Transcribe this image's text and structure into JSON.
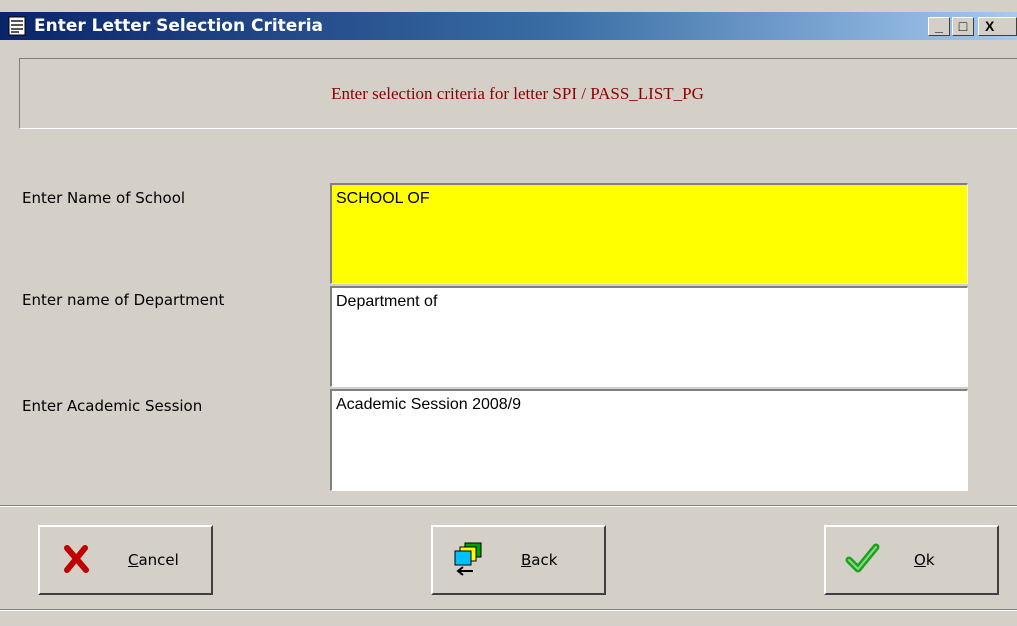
{
  "window": {
    "title": "Enter Letter Selection Criteria",
    "controls": {
      "minimize": "_",
      "maximize": "□",
      "close": "X"
    }
  },
  "header": {
    "text": "Enter selection criteria for letter SPI / PASS_LIST_PG",
    "color": "#8b0000"
  },
  "form": {
    "school": {
      "label": "Enter Name of School",
      "value": "SCHOOL OF",
      "highlight": "#ffff00"
    },
    "department": {
      "label": "Enter name of Department",
      "value": "Department of"
    },
    "session": {
      "label": "Enter Academic Session",
      "value": "Academic Session 2008/9"
    }
  },
  "buttons": {
    "cancel": {
      "mnemonic": "C",
      "rest": "ancel",
      "icon": "red-x-icon"
    },
    "back": {
      "mnemonic": "B",
      "rest": "ack",
      "icon": "back-folders-icon"
    },
    "ok": {
      "mnemonic": "O",
      "rest": "k",
      "icon": "green-check-icon"
    }
  }
}
